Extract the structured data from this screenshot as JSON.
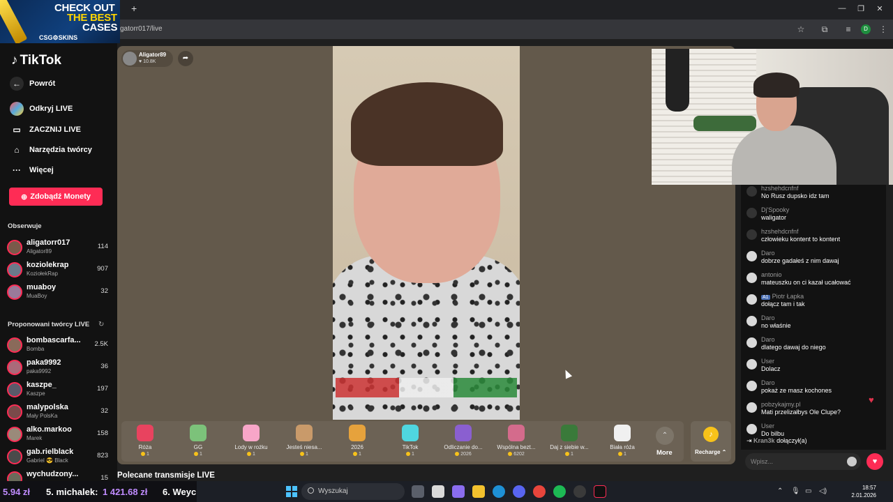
{
  "browser": {
    "url": "gatorr017/live",
    "new_tab": "+",
    "minimize": "—",
    "maximize": "❐",
    "close": "✕",
    "profile_initial": "D"
  },
  "ad": {
    "line1": "CHECK OUT",
    "line2": "THE BEST",
    "line3": "CASES",
    "brand": "CSG⚙SKINS"
  },
  "sidebar": {
    "logo": "TikTok",
    "nav": [
      {
        "label": "Powrót",
        "icon": "back-arrow-icon"
      },
      {
        "label": "Odkryj LIVE",
        "icon": "live-discover-icon"
      },
      {
        "label": "ZACZNIJ LIVE",
        "icon": "camera-icon"
      },
      {
        "label": "Narzędzia twórcy",
        "icon": "home-tools-icon"
      },
      {
        "label": "Więcej",
        "icon": "more-dots-icon"
      }
    ],
    "coins_button": "Zdobądź Monety",
    "following_title": "Obserwuje",
    "following": [
      {
        "name": "aligatorr017",
        "sub": "Aligator89",
        "count": "114"
      },
      {
        "name": "koziolekrap",
        "sub": "KoziołekRap",
        "count": "907"
      },
      {
        "name": "muaboy",
        "sub": "MuaBoy",
        "count": "32"
      }
    ],
    "suggested_title": "Proponowani twórcy LIVE",
    "suggested": [
      {
        "name": "bombascarfa...",
        "sub": "Bomba",
        "count": "2.5K"
      },
      {
        "name": "paka9992",
        "sub": "paka9992",
        "count": "36"
      },
      {
        "name": "kaszpe_",
        "sub": "Kaszpe",
        "count": "197"
      },
      {
        "name": "malypolska",
        "sub": "Mały PolsKa",
        "count": "32"
      },
      {
        "name": "alko.markoo",
        "sub": "Marek",
        "count": "158"
      },
      {
        "name": "gab.rielblack",
        "sub": "Gabriel 😎 Black",
        "count": "823"
      },
      {
        "name": "wychudzony...",
        "sub": "",
        "count": "15"
      }
    ]
  },
  "stream": {
    "streamer_name": "Aligator89",
    "viewers": "♥ 10.8K",
    "share": "➦"
  },
  "gifts": [
    {
      "name": "Róża",
      "price": "1",
      "color": "#e8435f"
    },
    {
      "name": "GG",
      "price": "1",
      "color": "#7cc27a"
    },
    {
      "name": "Lody w rożku",
      "price": "1",
      "color": "#f7a6c8"
    },
    {
      "name": "Jesteś niesa...",
      "price": "1",
      "color": "#c99a6a"
    },
    {
      "name": "2026",
      "price": "1",
      "color": "#e6a23c"
    },
    {
      "name": "TikTok",
      "price": "1",
      "color": "#4fd6e0"
    },
    {
      "name": "Odliczanie do...",
      "price": "2026",
      "color": "#8a5fd0"
    },
    {
      "name": "Wspólna bezt...",
      "price": "6202",
      "color": "#d46b8c"
    },
    {
      "name": "Daj z siebie w...",
      "price": "1",
      "color": "#3a7a3a"
    },
    {
      "name": "Biała róża",
      "price": "1",
      "color": "#f0f0f0"
    }
  ],
  "more_label": "More",
  "more_chevron": "⌃",
  "recharge_label": "Recharge ⌃",
  "chat": {
    "messages": [
      {
        "user": "hzshehdcnfnf",
        "text": "No Rusz dupsko idz tam",
        "dark": true
      },
      {
        "user": "Dj'Spooky",
        "text": "waligator",
        "dark": true
      },
      {
        "user": "hzshehdcnfnf",
        "text": "człowieku kontent to kontent",
        "dark": true
      },
      {
        "user": "Daro",
        "text": "dobrze gadałeś z nim dawaj",
        "dark": false
      },
      {
        "user": "antonio",
        "text": "mateuszku on ci kazał ucałować",
        "dark": false
      },
      {
        "user": "Piotr Łapka",
        "text": "dołącz tam i tak",
        "dark": false,
        "badge": "A1"
      },
      {
        "user": "Daro",
        "text": "no właśnie",
        "dark": false
      },
      {
        "user": "Daro",
        "text": "dlatego dawaj do niego",
        "dark": false
      },
      {
        "user": "User",
        "text": "Dolacz",
        "dark": false
      },
      {
        "user": "Daro",
        "text": "pokaż ze masz kochones",
        "dark": false
      },
      {
        "user": "pobzykajmy.pl",
        "text": "Mati przelizałbys Ole Clupe?",
        "dark": false
      },
      {
        "user": "User",
        "text": "Do bilbu",
        "dark": false
      }
    ],
    "join_user": "Kran3k",
    "join_text": "dołączył(a)",
    "input_placeholder": "Wpisz..."
  },
  "below_title": "Polecane transmisje LIVE",
  "ticker": [
    {
      "text": "5.94 zł",
      "color": "#c08cff"
    },
    {
      "text": "5. michalek:",
      "color": "#ffffff"
    },
    {
      "text": "1 421.68 zł",
      "color": "#c08cff"
    },
    {
      "text": "6. Weyc",
      "color": "#ffffff"
    }
  ],
  "taskbar": {
    "search_placeholder": "Wyszukaj",
    "time": "18:57",
    "date": "2.01.2026"
  }
}
